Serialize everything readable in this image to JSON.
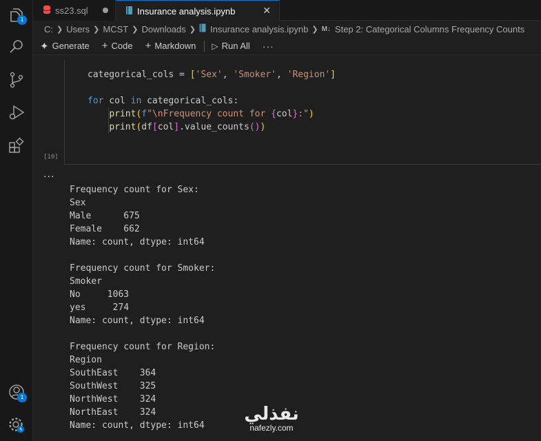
{
  "activity_bar": {
    "explorer_badge": "1",
    "accounts_badge": "1"
  },
  "tabs": [
    {
      "label": "ss23.sql",
      "icon": "database-icon",
      "modified": true
    },
    {
      "label": "Insurance analysis.ipynb",
      "icon": "notebook-icon",
      "active": true
    }
  ],
  "breadcrumb": {
    "parts": [
      "C:",
      "Users",
      "MCST",
      "Downloads",
      "Insurance analysis.ipynb"
    ],
    "md_marker": "M↓",
    "section": "Step 2: Categorical Columns Frequency Counts"
  },
  "toolbar": {
    "generate": "Generate",
    "code": "Code",
    "markdown": "Markdown",
    "run_all": "Run All",
    "more": "···"
  },
  "cell": {
    "execution_count": "[10]",
    "output_more": "···"
  },
  "output_lines": [
    "Frequency count for Sex:",
    "Sex",
    "Male      675",
    "Female    662",
    "Name: count, dtype: int64",
    "",
    "Frequency count for Smoker:",
    "Smoker",
    "No     1063",
    "yes     274",
    "Name: count, dtype: int64",
    "",
    "Frequency count for Region:",
    "Region",
    "SouthEast    364",
    "SouthWest    325",
    "NorthWest    324",
    "NorthEast    324",
    "Name: count, dtype: int64"
  ],
  "watermark": {
    "arabic": "نفذلي",
    "url": "nafezly.com"
  },
  "colors": {
    "accent": "#0078d4",
    "keyword": "#569cd6",
    "string": "#ce9178",
    "function": "#dcdcaa"
  }
}
